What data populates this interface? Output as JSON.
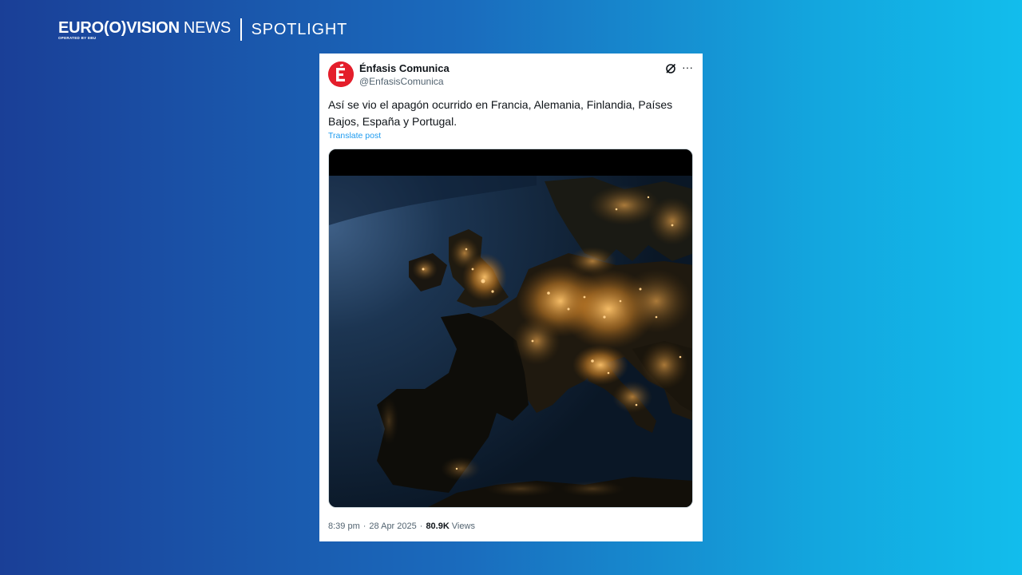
{
  "brand": {
    "euro_text": "EURO",
    "vision_text": "(O)VISION",
    "news_text": "NEWS",
    "operated_text": "OPERATED BY EBU",
    "section_text": "SPOTLIGHT"
  },
  "tweet": {
    "author_name": "Énfasis Comunica",
    "author_handle": "@EnfasisComunica",
    "avatar_letter": "É",
    "text": "Así se vio el apagón ocurrido en Francia, Alemania, Finlandia,  Países Bajos, España y Portugal.",
    "translate_label": "Translate post",
    "time": "8:39 pm",
    "date": "28 Apr 2025",
    "views_count": "80.9K",
    "views_label": "Views",
    "separator": "·",
    "more_label": "···"
  },
  "colors": {
    "avatar_red": "#e41e2b",
    "link_blue": "#1d9bf0",
    "city_light": "#ffb347"
  }
}
